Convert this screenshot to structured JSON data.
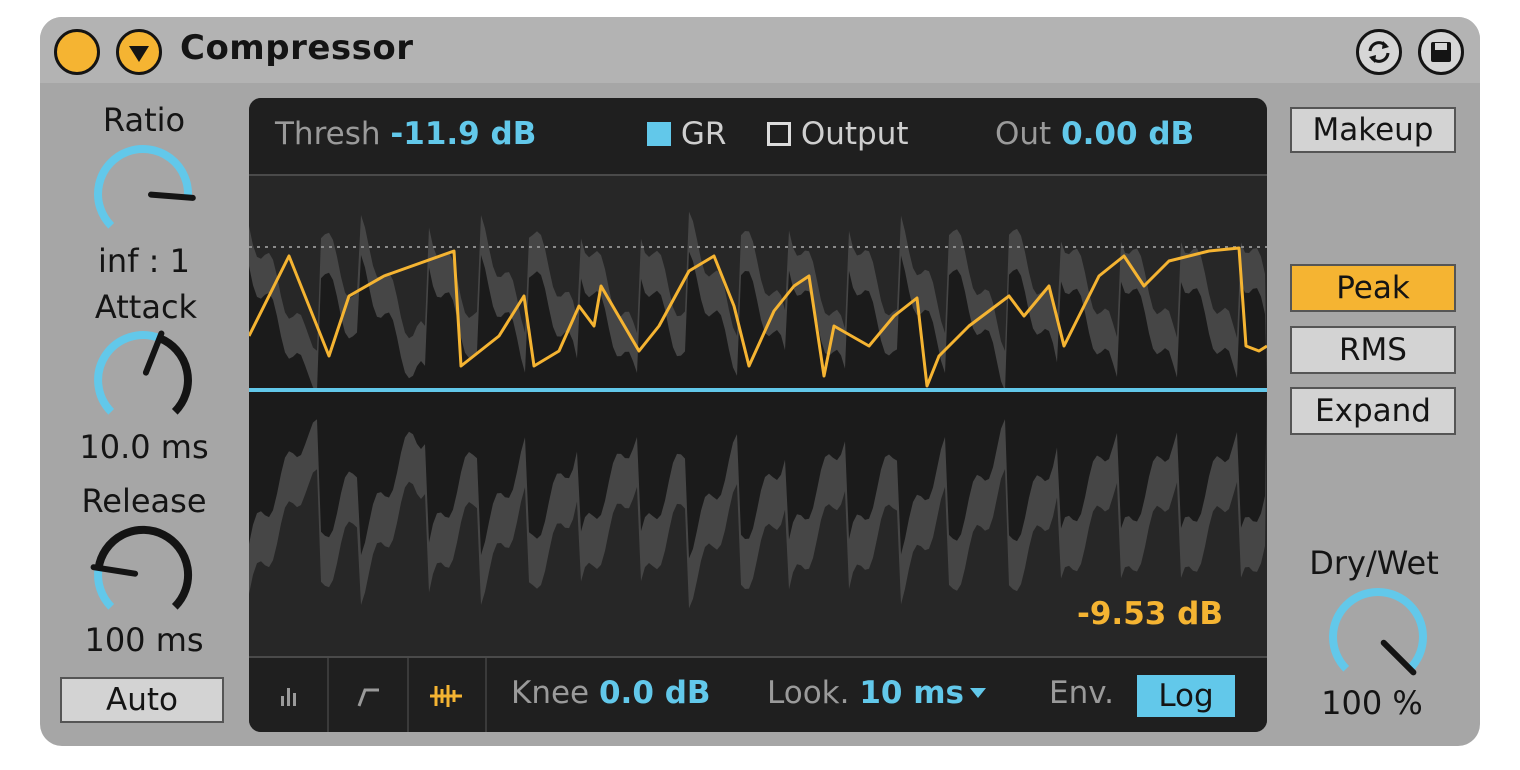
{
  "device": {
    "title": "Compressor",
    "power_state": "on",
    "colors": {
      "accent": "#f5b432",
      "blue": "#62c8ea",
      "panel": "#a6a6a6",
      "display": "#2b2b2b"
    }
  },
  "knobs": {
    "ratio": {
      "label": "Ratio",
      "value": "inf : 1",
      "level": 0.85
    },
    "attack": {
      "label": "Attack",
      "value": "10.0 ms",
      "level": 0.58
    },
    "release": {
      "label": "Release",
      "value": "100 ms",
      "level": 0.2
    }
  },
  "auto_button": {
    "label": "Auto",
    "active": false
  },
  "display": {
    "thresh_label": "Thresh",
    "thresh_value": "-11.9 dB",
    "gr_label": "GR",
    "gr_checked": true,
    "output_label": "Output",
    "output_checked": false,
    "out_label": "Out",
    "out_value": "0.00 dB",
    "gain_reduction_value": "-9.53 dB",
    "knee_label": "Knee",
    "knee_value": "0.0 dB",
    "lookahead_label": "Look.",
    "lookahead_value": "10 ms",
    "env_label": "Env.",
    "env_mode": "Log",
    "view_modes": [
      "collapsed-view-icon",
      "transfer-curve-icon",
      "activity-view-icon"
    ],
    "active_view": "activity-view-icon"
  },
  "right_buttons": {
    "makeup": {
      "label": "Makeup",
      "active": false
    },
    "peak": {
      "label": "Peak",
      "active": true
    },
    "rms": {
      "label": "RMS",
      "active": false
    },
    "expand": {
      "label": "Expand",
      "active": false
    }
  },
  "dry_wet": {
    "label": "Dry/Wet",
    "value": "100 %",
    "level": 1.0
  }
}
